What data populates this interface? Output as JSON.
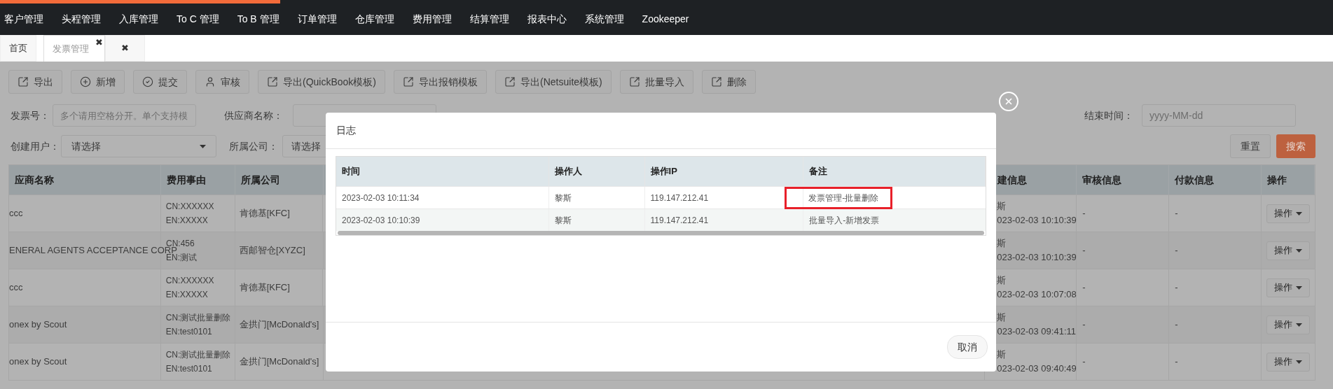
{
  "nav": {
    "items": [
      "客户管理",
      "头程管理",
      "入库管理",
      "To C 管理",
      "To B 管理",
      "订单管理",
      "仓库管理",
      "费用管理",
      "结算管理",
      "报表中心",
      "系统管理",
      "Zookeeper"
    ]
  },
  "tabs": [
    {
      "label": "首页",
      "selected": false
    },
    {
      "label": "发票管理",
      "selected": true,
      "close_glyph": "✖"
    },
    {
      "close_glyph": "✖",
      "selected": false
    }
  ],
  "toolbar": [
    {
      "label": "导出",
      "kind": "share"
    },
    {
      "label": "新增",
      "kind": "plus"
    },
    {
      "label": "提交",
      "kind": "check"
    },
    {
      "label": "审核",
      "kind": "user"
    },
    {
      "label": "导出(QuickBook模板)",
      "kind": "share"
    },
    {
      "label": "导出报销模板",
      "kind": "share"
    },
    {
      "label": "导出(Netsuite模板)",
      "kind": "share"
    },
    {
      "label": "批量导入",
      "kind": "share"
    },
    {
      "label": "删除",
      "kind": "share"
    }
  ],
  "filters": {
    "invoice_no": {
      "label": "发票号：",
      "placeholder": "多个请用空格分开。单个支持模"
    },
    "supplier": {
      "label": "供应商名称："
    },
    "end_time": {
      "label": "结束时间：",
      "placeholder": "yyyy-MM-dd"
    },
    "creator": {
      "label": "创建用户：",
      "value": "请选择"
    },
    "company": {
      "label": "所属公司：",
      "value": "请选择"
    },
    "reset": "重置",
    "search": "搜索"
  },
  "table": {
    "columns": [
      "应商名称",
      "费用事由",
      "所属公司",
      "建信息",
      "审核信息",
      "付款信息",
      "操作"
    ],
    "rows": [
      {
        "supplier": "ccc",
        "reason_cn": "CN:XXXXXX",
        "reason_en": "EN:XXXXX",
        "company": "肯德基[KFC]",
        "creator": "斯",
        "created": "023-02-03 10:10:39",
        "audit": "-",
        "payment": "-",
        "action": "操作"
      },
      {
        "supplier": "ENERAL AGENTS ACCEPTANCE CORP",
        "reason_cn": "CN:456",
        "reason_en": "EN:测试",
        "company": "西邮智仓[XYZC]",
        "creator": "斯",
        "created": "023-02-03 10:10:39",
        "audit": "-",
        "payment": "-",
        "action": "操作"
      },
      {
        "supplier": "ccc",
        "reason_cn": "CN:XXXXXX",
        "reason_en": "EN:XXXXX",
        "company": "肯德基[KFC]",
        "creator": "斯",
        "created": "023-02-03 10:07:08",
        "audit": "-",
        "payment": "-",
        "action": "操作"
      },
      {
        "supplier": "onex by Scout",
        "reason_cn": "CN:测试批量删除",
        "reason_en": "EN:test0101",
        "company": "金拱门[McDonald's]",
        "creator": "斯",
        "created": "023-02-03 09:41:11",
        "audit": "-",
        "payment": "-",
        "action": "操作"
      },
      {
        "supplier": "onex by Scout",
        "reason_cn": "CN:测试批量删除",
        "reason_en": "EN:test0101",
        "company": "金拱门[McDonald's]",
        "creator": "斯",
        "created": "023-02-03 09:40:49",
        "audit": "-",
        "payment": "-",
        "action": "操作"
      }
    ]
  },
  "modal": {
    "title": "日志",
    "columns": [
      "时间",
      "操作人",
      "操作IP",
      "备注"
    ],
    "rows": [
      {
        "time": "2023-02-03 10:11:34",
        "operator": "黎斯",
        "ip": "119.147.212.41",
        "remark": "发票管理-批量删除",
        "highlighted": true
      },
      {
        "time": "2023-02-03 10:10:39",
        "operator": "黎斯",
        "ip": "119.147.212.41",
        "remark": "批量导入-新增发票",
        "highlighted": false
      }
    ],
    "cancel": "取消"
  }
}
